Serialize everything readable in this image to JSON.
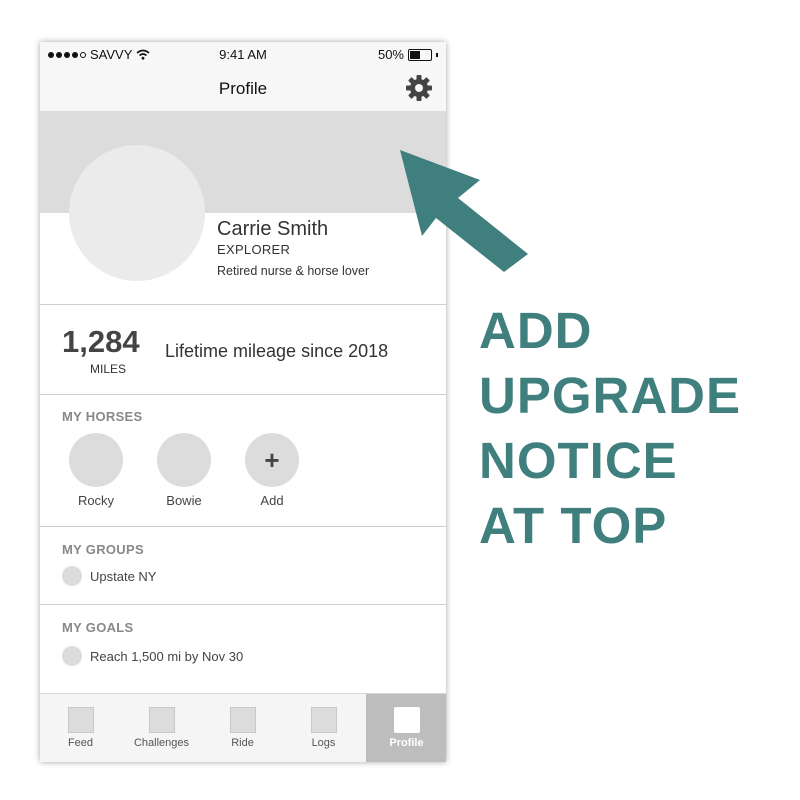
{
  "status_bar": {
    "carrier": "SAVVY",
    "time": "9:41 AM",
    "battery_percent_label": "50%",
    "battery_level": 0.5
  },
  "nav": {
    "title": "Profile",
    "settings_icon": "gear-icon"
  },
  "profile": {
    "name": "Carrie Smith",
    "level": "EXPLORER",
    "bio": "Retired nurse & horse lover"
  },
  "mileage": {
    "value": "1,284",
    "unit": "MILES",
    "description": "Lifetime mileage since 2018"
  },
  "horses": {
    "title": "MY HORSES",
    "items": [
      {
        "label": "Rocky"
      },
      {
        "label": "Bowie"
      },
      {
        "label": "Add",
        "icon_glyph": "+"
      }
    ]
  },
  "groups": {
    "title": "MY GROUPS",
    "items": [
      {
        "label": "Upstate NY"
      }
    ]
  },
  "goals": {
    "title": "MY GOALS",
    "items": [
      {
        "label": "Reach 1,500 mi by Nov 30"
      }
    ]
  },
  "tabs": [
    {
      "label": "Feed",
      "active": false
    },
    {
      "label": "Challenges",
      "active": false
    },
    {
      "label": "Ride",
      "active": false
    },
    {
      "label": "Logs",
      "active": false
    },
    {
      "label": "Profile",
      "active": true
    }
  ],
  "annotation": {
    "lines": [
      "ADD",
      "UPGRADE",
      "NOTICE",
      "AT TOP"
    ],
    "color": "#3f7f7d"
  }
}
